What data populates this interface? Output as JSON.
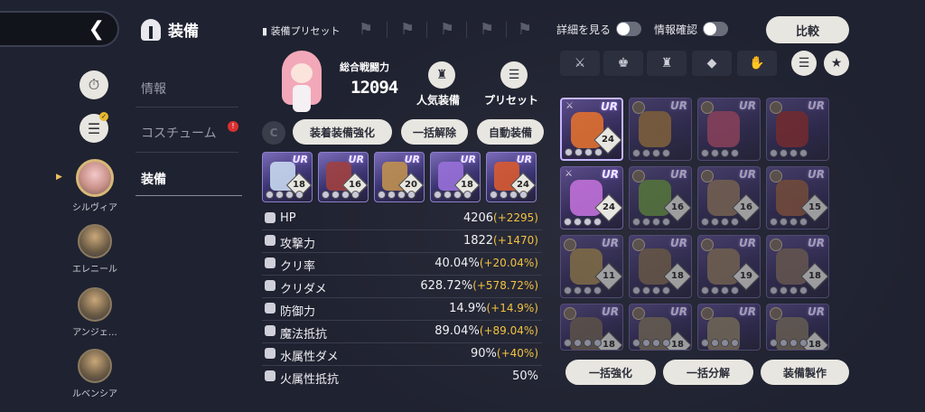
{
  "nav": {
    "back_icon": "chevron-left-icon"
  },
  "side_buttons": [
    {
      "icon": "stopwatch-icon"
    },
    {
      "icon": "list-filter-icon",
      "badge": true
    }
  ],
  "characters": [
    {
      "name": "シルヴィア",
      "selected": true
    },
    {
      "name": "エレニール",
      "selected": false
    },
    {
      "name": "アンジェ…",
      "selected": false
    },
    {
      "name": "ルベンシア",
      "selected": false
    }
  ],
  "menu": {
    "title": "装備",
    "items": [
      {
        "label": "情報",
        "active": false
      },
      {
        "label": "コスチューム",
        "active": false,
        "badge": "!"
      },
      {
        "label": "装備",
        "active": true
      }
    ]
  },
  "preset": {
    "label": "装備プリセット",
    "slots": 8
  },
  "power": {
    "label": "総合戦闘力",
    "value": "12094"
  },
  "quick": {
    "popular_label": "人気装備",
    "preset_label": "プリセット"
  },
  "actions": {
    "c_label": "C",
    "enhance_equipped": "装着装備強化",
    "unequip_all": "一括解除",
    "auto_equip": "自動装備"
  },
  "equipped": [
    {
      "grade": "UR",
      "level": "18",
      "color": "#c8d8f0"
    },
    {
      "grade": "UR",
      "level": "16",
      "color": "#a04040"
    },
    {
      "grade": "UR",
      "level": "20",
      "color": "#c09050"
    },
    {
      "grade": "UR",
      "level": "18",
      "color": "#9870d8"
    },
    {
      "grade": "UR",
      "level": "24",
      "color": "#d85a30"
    }
  ],
  "stats": [
    {
      "name": "HP",
      "value": "4206",
      "bonus": "(+2295)",
      "icon": "heart-icon"
    },
    {
      "name": "攻撃力",
      "value": "1822",
      "bonus": "(+1470)",
      "icon": "sword-icon"
    },
    {
      "name": "クリ率",
      "value": "40.04%",
      "bonus": "(+20.04%)",
      "icon": "crit-rate-icon"
    },
    {
      "name": "クリダメ",
      "value": "628.72%",
      "bonus": "(+578.72%)",
      "icon": "crit-damage-icon"
    },
    {
      "name": "防御力",
      "value": "14.9%",
      "bonus": "(+14.9%)",
      "icon": "shield-icon"
    },
    {
      "name": "魔法抵抗",
      "value": "89.04%",
      "bonus": "(+89.04%)",
      "icon": "magic-shield-icon"
    },
    {
      "name": "水属性ダメ",
      "value": "90%",
      "bonus": "(+40%)",
      "icon": "water-icon"
    },
    {
      "name": "火属性抵抗",
      "value": "50%",
      "bonus": "",
      "icon": "fire-shield-icon"
    }
  ],
  "right": {
    "details_label": "詳細を見る",
    "info_label": "情報確認",
    "compare_label": "比較",
    "filters": [
      "weapon-icon",
      "armor-icon",
      "helmet-icon",
      "amulet-icon",
      "glove-icon"
    ]
  },
  "inventory": [
    {
      "grade": "UR",
      "level": "24",
      "color": "#e07030",
      "sel": true,
      "dim": false
    },
    {
      "grade": "UR",
      "level": "",
      "color": "#b08040",
      "sel": false,
      "dim": true
    },
    {
      "grade": "UR",
      "level": "",
      "color": "#c05070",
      "sel": false,
      "dim": true
    },
    {
      "grade": "UR",
      "level": "",
      "color": "#a03030",
      "sel": false,
      "dim": true
    },
    {
      "grade": "UR",
      "level": "24",
      "color": "#c070d8",
      "sel": false,
      "dim": false
    },
    {
      "grade": "UR",
      "level": "16",
      "color": "#70a040",
      "sel": false,
      "dim": true
    },
    {
      "grade": "UR",
      "level": "16",
      "color": "#a08060",
      "sel": false,
      "dim": true
    },
    {
      "grade": "UR",
      "level": "15",
      "color": "#a06040",
      "sel": false,
      "dim": true
    },
    {
      "grade": "UR",
      "level": "11",
      "color": "#b09050",
      "sel": false,
      "dim": true
    },
    {
      "grade": "UR",
      "level": "18",
      "color": "#8a7050",
      "sel": false,
      "dim": true
    },
    {
      "grade": "UR",
      "level": "19",
      "color": "#9a8060",
      "sel": false,
      "dim": true
    },
    {
      "grade": "UR",
      "level": "18",
      "color": "#8a7060",
      "sel": false,
      "dim": true
    },
    {
      "grade": "UR",
      "level": "18",
      "color": "#7a6a58",
      "sel": false,
      "dim": true
    },
    {
      "grade": "UR",
      "level": "18",
      "color": "#8a7a60",
      "sel": false,
      "dim": true
    },
    {
      "grade": "UR",
      "level": "",
      "color": "#9a8a6a",
      "sel": false,
      "dim": true
    },
    {
      "grade": "UR",
      "level": "18",
      "color": "#8a7a64",
      "sel": false,
      "dim": true
    }
  ],
  "bottom": {
    "bulk_enhance": "一括強化",
    "bulk_dismantle": "一括分解",
    "craft": "装備製作"
  }
}
